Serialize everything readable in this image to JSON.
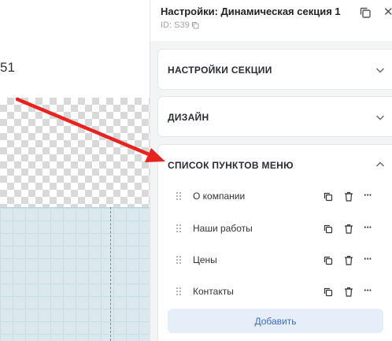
{
  "canvas": {
    "partial_number": "51"
  },
  "panel": {
    "title": "Настройки: Динамическая секция 1",
    "id_label": "ID: S39"
  },
  "sections": {
    "settings": "НАСТРОЙКИ СЕКЦИИ",
    "design": "ДИЗАЙН",
    "menu_list": "СПИСОК ПУНКТОВ МЕНЮ"
  },
  "menu_items": [
    {
      "label": "О компании"
    },
    {
      "label": "Наши работы"
    },
    {
      "label": "Цены"
    },
    {
      "label": "Контакты"
    }
  ],
  "add_button": "Добавить",
  "colors": {
    "arrow": "#e8231f",
    "accent": "#3a6fc9",
    "button_bg": "#e6eef9"
  },
  "icons": [
    "copy-icon",
    "close-icon",
    "chevron-down-icon",
    "chevron-up-icon",
    "drag-handle-icon",
    "trash-icon",
    "more-icon"
  ]
}
